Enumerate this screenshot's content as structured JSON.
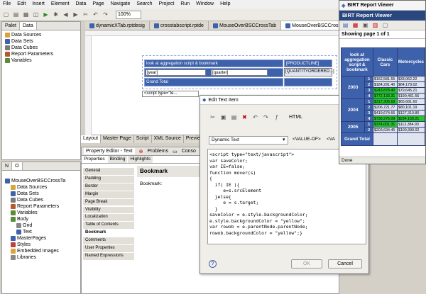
{
  "menu": [
    "File",
    "Edit",
    "Insert",
    "Element",
    "Data",
    "Page",
    "Navigate",
    "Search",
    "Project",
    "Run",
    "Window",
    "Help"
  ],
  "zoom": "100%",
  "top_left_tabs": [
    "Palet",
    "Data"
  ],
  "data_tree": [
    "Data Sources",
    "Data Sets",
    "Data Cubes",
    "Report Parameters",
    "Variables"
  ],
  "editor_tabs": [
    "dynamicXTab.rptdesig",
    "crosstabscript.rptde",
    "MouseOverBSCCrossTab",
    "MouseOverBSCCrossTab"
  ],
  "crosstab": {
    "title": "look at aggregation script & bookmark",
    "col_field": "[PRODUCTLINE]",
    "row_field": "[year]",
    "row_field2": "[quarter]",
    "measure": "[QUANTITYORDERED...]",
    "grand_total": "Grand Total"
  },
  "script_stub": "<script type=\"te...",
  "bottom_tabs": [
    "Layout",
    "Master Page",
    "Script",
    "XML Source",
    "Preview"
  ],
  "outline_tabs": [
    "N",
    "O"
  ],
  "outline_tree": [
    "MouseOverBSCCrossTa",
    "Data Sources",
    "Data Sets",
    "Data Cubes",
    "Report Parameters",
    "Variables",
    "Body",
    "Grid",
    "Text",
    "MasterPages",
    "Styles",
    "Embedded Images",
    "Libraries"
  ],
  "property_panel": {
    "tabs": [
      "Property Editor - Text",
      "Problems",
      "Conso"
    ],
    "subtabs": [
      "Properties",
      "Binding",
      "Highlights"
    ],
    "heading": "Bookmark",
    "field_label": "Bookmark:"
  },
  "property_categories": [
    "General",
    "Padding",
    "Border",
    "Margin",
    "Page Break",
    "Visibility",
    "Localization",
    "Table of Contents",
    "Bookmark",
    "Comments",
    "User Properties",
    "Named Expressions"
  ],
  "dialog": {
    "title": "Edit Text Item",
    "mode": "HTML",
    "type_value": "Dynamic Text",
    "tag1": "<VALUE-OF>",
    "tag2": "<VA",
    "ok": "OK",
    "cancel": "Cancel",
    "help": "?"
  },
  "code_lines": [
    "<script type=\"text/javascript\">",
    "var saveColor;",
    "var IE=false;",
    "function mover(s)",
    "{",
    "  if( IE ){",
    "     e=s.srcElement",
    "  }else{",
    "     e = s.target;",
    "  }",
    "saveColor = e.style.backgroundColor;",
    "e.style.backgroundColor = \"yellow\";",
    "var rowob = e.parentNode.parentNode;",
    "rowob.backgroundColor = \"yellow\";}"
  ],
  "viewer": {
    "window_title": "BIRT Report Viewer",
    "header": "BIRT Report Viewer",
    "paging": "Showing page  1  of  1",
    "status": "Done",
    "corner": "look at aggregation script & bookmark",
    "col1": "Classic Cars",
    "col2": "Motorcycles",
    "grand_total": "Grand Total"
  },
  "viewer_rows": [
    {
      "year": "2003",
      "q": "1",
      "v1": "$152,581.55",
      "v2": "$33,062.22",
      "hl": ""
    },
    {
      "year": "",
      "q": "2",
      "v1": "$184,291.40",
      "v2": "$64,179.02",
      "hl": ""
    },
    {
      "year": "",
      "q": "3",
      "v1": "$243,878.40",
      "v2": "$79,645.21",
      "hl": "green"
    },
    {
      "year": "",
      "q": "4",
      "v1": "$772,133.31",
      "v2": "$190,461.56",
      "hl": "green"
    },
    {
      "year": "2004",
      "q": "1",
      "v1": "$317,306.69",
      "v2": "$65,681.60",
      "hl": "green"
    },
    {
      "year": "",
      "q": "2",
      "v1": "$206,721.77",
      "v2": "$80,101.19",
      "hl": ""
    },
    {
      "year": "",
      "q": "3",
      "v1": "$419,674.66",
      "v2": "$127,310.80",
      "hl": ""
    },
    {
      "year": "",
      "q": "4",
      "v1": "$739,276.09",
      "v2": "$234,150.21",
      "hl": "row"
    },
    {
      "year": "2005",
      "q": "1",
      "v1": "$374,001.31",
      "v2": "$112,384.93",
      "hl": "green"
    },
    {
      "year": "",
      "q": "2",
      "v1": "$203,634.45",
      "v2": "$100,390.02",
      "hl": ""
    }
  ]
}
